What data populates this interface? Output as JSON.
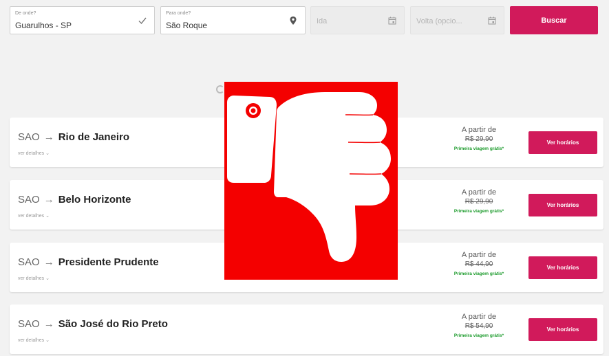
{
  "search": {
    "origin": {
      "label": "De onde?",
      "value": "Guarulhos - SP",
      "icon": "check-icon"
    },
    "destination": {
      "label": "Para onde?",
      "value": "São Roque",
      "icon": "location-pin-icon"
    },
    "departure": {
      "placeholder": "Ida",
      "icon": "calendar-icon"
    },
    "return": {
      "placeholder": "Volta (opcio...",
      "icon": "calendar-icon"
    },
    "button": "Buscar"
  },
  "results": [
    {
      "origin": "SAO",
      "destination": "Rio de Janeiro",
      "details": "ver detalhes",
      "from_label": "A partir de",
      "price": "R$ 29,90",
      "promo": "Primeira viagem grátis*",
      "button": "Ver horários"
    },
    {
      "origin": "SAO",
      "destination": "Belo Horizonte",
      "details": "ver detalhes",
      "from_label": "A partir de",
      "price": "R$ 29,90",
      "promo": "Primeira viagem grátis*",
      "button": "Ver horários"
    },
    {
      "origin": "SAO",
      "destination": "Presidente Prudente",
      "details": "ver detalhes",
      "from_label": "A partir de",
      "price": "R$ 44,90",
      "promo": "Primeira viagem grátis*",
      "button": "Ver horários"
    },
    {
      "origin": "SAO",
      "destination": "São José do Rio Preto",
      "details": "ver detalhes",
      "from_label": "A partir de",
      "price": "R$ 54,90",
      "promo": "Primeira viagem grátis*",
      "button": "Ver horários"
    }
  ],
  "overlay": {
    "icon": "thumbs-down-icon",
    "background": "#f40000"
  },
  "colors": {
    "accent": "#d11a5b",
    "promo": "#1a9a2a"
  }
}
